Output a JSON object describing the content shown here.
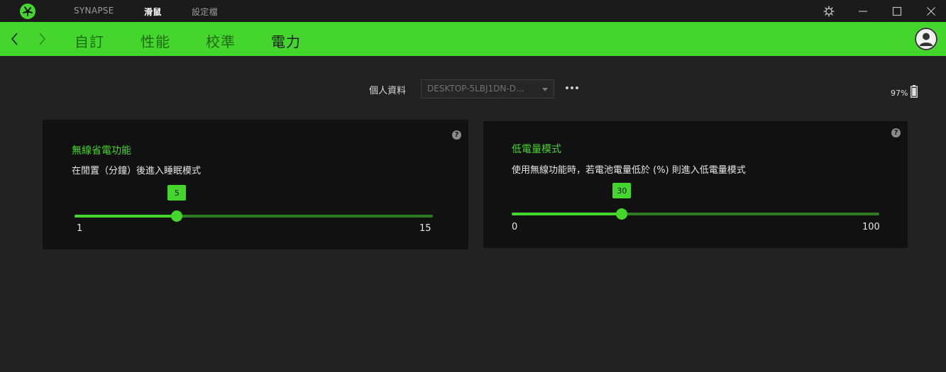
{
  "topnav": {
    "items": [
      {
        "label": "SYNAPSE",
        "active": false
      },
      {
        "label": "滑鼠",
        "active": true
      },
      {
        "label": "設定檔",
        "active": false
      }
    ]
  },
  "tabs": [
    {
      "label": "自訂",
      "active": false
    },
    {
      "label": "性能",
      "active": false
    },
    {
      "label": "校準",
      "active": false
    },
    {
      "label": "電力",
      "active": true
    }
  ],
  "profile": {
    "label": "個人資料",
    "selected": "DESKTOP-5LBJ1DN-D..."
  },
  "battery": {
    "text": "97%",
    "level": 0.97
  },
  "cards": {
    "sleep": {
      "title": "無線省電功能",
      "description": "在閒置（分鐘）後進入睡眠模式",
      "min": 1,
      "max": 15,
      "value": 5,
      "min_label": "1",
      "max_label": "15",
      "value_label": "5"
    },
    "lowpower": {
      "title": "低電量模式",
      "description": "使用無線功能時，若電池電量低於 (%) 則進入低電量模式",
      "min": 0,
      "max": 100,
      "value": 30,
      "min_label": "0",
      "max_label": "100",
      "value_label": "30"
    }
  },
  "help": {
    "symbol": "?"
  },
  "colors": {
    "accent": "#44d62c",
    "background": "#222222",
    "card": "#111111",
    "titlebar": "#1b1b1b"
  }
}
